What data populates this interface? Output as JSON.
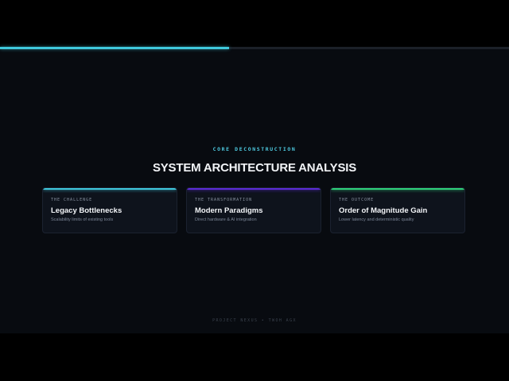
{
  "progress": {
    "fraction": 0.45,
    "fill_color": "#3fc8dc"
  },
  "slide": {
    "eyebrow": "CORE DECONSTRUCTION",
    "title": "SYSTEM ARCHITECTURE ANALYSIS",
    "cards": [
      {
        "label": "THE CHALLENGE",
        "heading": "Legacy Bottlenecks",
        "description": "Scalability limits of existing tools",
        "accent_color": "#3fc8dc"
      },
      {
        "label": "THE TRANSFORMATION",
        "heading": "Modern Paradigms",
        "description": "Direct hardware & AI integration",
        "accent_color": "#5b2bd6"
      },
      {
        "label": "THE OUTCOME",
        "heading": "Order of Magnitude Gain",
        "description": "Lower latency and deterministic quality",
        "accent_color": "#2fd17a"
      }
    ],
    "footer": "PROJECT NEXUS • TWOH AGX"
  }
}
